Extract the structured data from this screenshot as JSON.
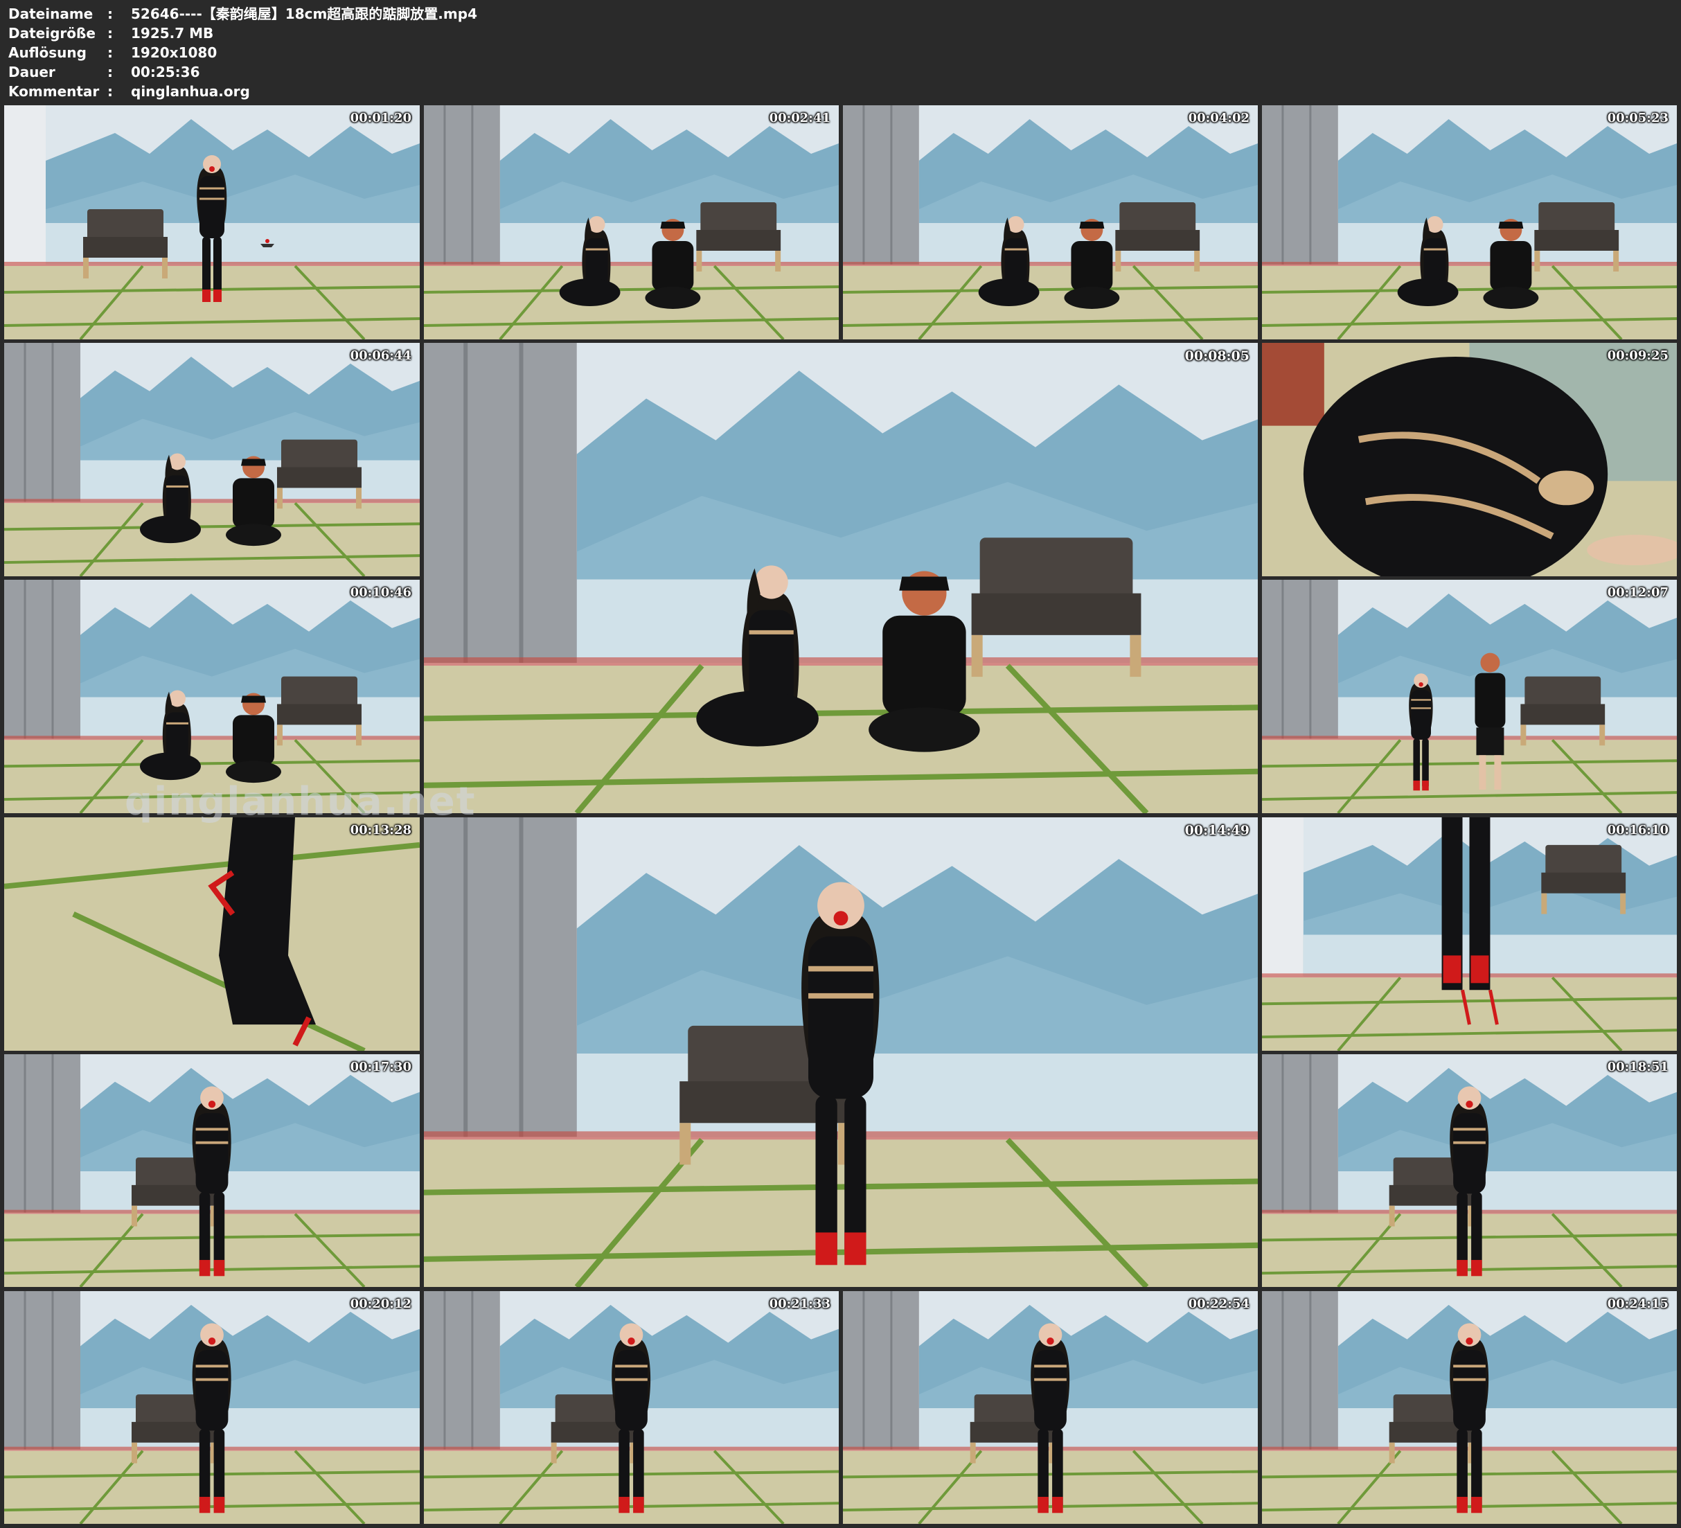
{
  "header": {
    "rows": [
      {
        "label": "Dateiname",
        "sep": ":",
        "value": "52646----【秦韵绳屋】18cm超高跟的踮脚放置.mp4"
      },
      {
        "label": "Dateigröße",
        "sep": ":",
        "value": "1925.7 MB"
      },
      {
        "label": "Auflösung",
        "sep": ":",
        "value": "1920x1080"
      },
      {
        "label": "Dauer",
        "sep": ":",
        "value": "00:25:36"
      },
      {
        "label": "Kommentar",
        "sep": ":",
        "value": "qinglanhua.org"
      }
    ]
  },
  "thumbnails": [
    {
      "time": "00:01:20",
      "scene": "seated"
    },
    {
      "time": "00:02:41",
      "scene": "kneel-pair"
    },
    {
      "time": "00:04:02",
      "scene": "kneel-pair"
    },
    {
      "time": "00:05:23",
      "scene": "kneel-pair"
    },
    {
      "time": "00:06:44",
      "scene": "kneel-pair"
    },
    {
      "time": "00:08:05",
      "scene": "kneel-pair"
    },
    {
      "time": "00:09:25",
      "scene": "closeup-back"
    },
    {
      "time": "00:10:46",
      "scene": "kneel-pair"
    },
    {
      "time": "00:12:07",
      "scene": "standing-pair"
    },
    {
      "time": "00:13:28",
      "scene": "closeup-boot"
    },
    {
      "time": "00:14:49",
      "scene": "standing"
    },
    {
      "time": "00:16:10",
      "scene": "closeup-legs"
    },
    {
      "time": "00:17:30",
      "scene": "standing"
    },
    {
      "time": "00:18:51",
      "scene": "standing"
    },
    {
      "time": "00:20:12",
      "scene": "standing"
    },
    {
      "time": "00:21:33",
      "scene": "standing"
    },
    {
      "time": "00:22:54",
      "scene": "standing"
    },
    {
      "time": "00:24:15",
      "scene": "standing"
    }
  ],
  "watermark": "qinglanhua.net",
  "colors": {
    "background": "#2a2a2a",
    "text": "#ffffff",
    "mountain": "#5f9bb8",
    "floor": "#cfcaa4",
    "floor_line": "#6f9a3a",
    "latex": "#121214",
    "accent": "#d01a1a"
  }
}
